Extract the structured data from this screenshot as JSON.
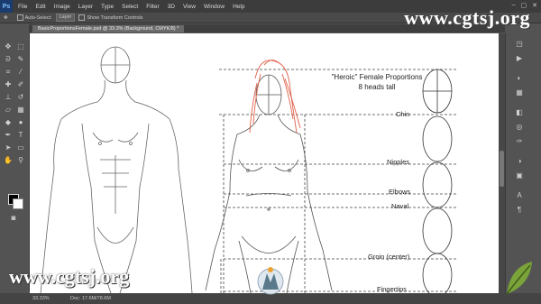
{
  "app": {
    "logo": "Ps",
    "brand_color": "#1a3c6e"
  },
  "menubar": {
    "items": [
      "File",
      "Edit",
      "Image",
      "Layer",
      "Type",
      "Select",
      "Filter",
      "3D",
      "View",
      "Window",
      "Help"
    ]
  },
  "options": {
    "auto_select_label": "Auto-Select:",
    "auto_select_value": "Layer",
    "transform_label": "Show Transform Controls"
  },
  "document": {
    "tab_title": "BasicProportionsFemale.psd @ 33.3% (Background, CMYK/8) *"
  },
  "canvas": {
    "title_line1": "\"Heroic\" Female Proportions",
    "title_line2": "8 heads tall",
    "landmarks": [
      "Chin",
      "Nipples",
      "Elbows",
      "Naval",
      "Groin (center)",
      "Fingertips"
    ],
    "hair_color": "#e0604a"
  },
  "status": {
    "zoom": "33.33%",
    "doc": "Doc: 17.6M/78.6M"
  },
  "watermark": {
    "text": "www.cgtsj.org"
  }
}
